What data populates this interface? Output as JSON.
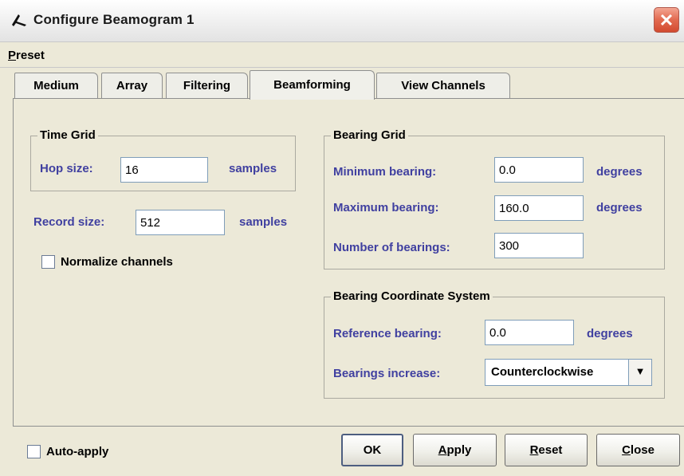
{
  "window": {
    "title": "Configure Beamogram 1",
    "close_label": "✕",
    "icon": "app-icon"
  },
  "menu": {
    "preset_first": "P",
    "preset_rest": "reset"
  },
  "tabs": [
    {
      "label": "Medium",
      "active": false
    },
    {
      "label": "Array",
      "active": false
    },
    {
      "label": "Filtering",
      "active": false
    },
    {
      "label": "Beamforming",
      "active": true
    },
    {
      "label": "View Channels",
      "active": false
    }
  ],
  "time_grid": {
    "title": "Time Grid",
    "hop_label": "Hop size:",
    "hop_value": "16",
    "hop_unit": "samples"
  },
  "record": {
    "label": "Record size:",
    "value": "512",
    "unit": "samples"
  },
  "normalize": {
    "label": "Normalize channels",
    "checked": false
  },
  "bearing_grid": {
    "title": "Bearing Grid",
    "min_label": "Minimum bearing:",
    "min_value": "0.0",
    "min_unit": "degrees",
    "max_label": "Maximum bearing:",
    "max_value": "160.0",
    "max_unit": "degrees",
    "num_label": "Number of bearings:",
    "num_value": "300"
  },
  "coord_system": {
    "title": "Bearing Coordinate System",
    "ref_label": "Reference bearing:",
    "ref_value": "0.0",
    "ref_unit": "degrees",
    "inc_label": "Bearings increase:",
    "inc_value": "Counterclockwise",
    "dropdown_glyph": "▼"
  },
  "footer": {
    "auto_apply_label": "Auto-apply",
    "auto_apply_checked": false,
    "ok_label": "OK",
    "apply_first": "A",
    "apply_rest": "pply",
    "reset_first": "R",
    "reset_rest": "eset",
    "close_first": "C",
    "close_rest": "lose"
  }
}
